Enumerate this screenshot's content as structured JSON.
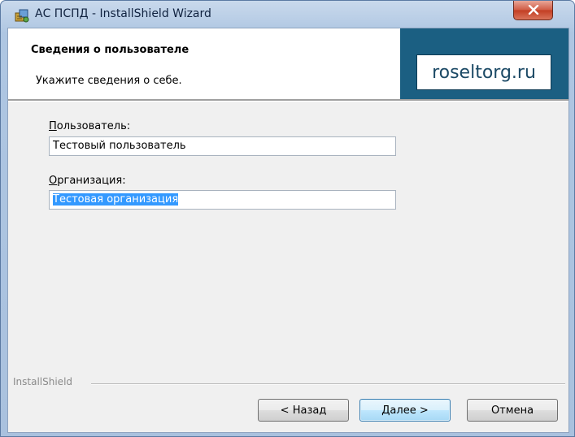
{
  "window": {
    "title": "АС ПСПД - InstallShield Wizard",
    "icon": "installer-icon",
    "close_icon": "close-icon"
  },
  "header": {
    "title": "Сведения о пользователе",
    "subtitle": "Укажите сведения о себе.",
    "brand": "roseltorg.ru"
  },
  "form": {
    "user": {
      "label_hotkey": "П",
      "label_rest": "ользователь:",
      "value": "Тестовый пользователь"
    },
    "org": {
      "label_hotkey": "О",
      "label_rest": "рганизация:",
      "value": "Тестовая организация",
      "selected": true
    }
  },
  "footer": {
    "brand": "InstallShield"
  },
  "buttons": {
    "back": "< Назад",
    "next": "Далее >",
    "cancel": "Отмена"
  },
  "colors": {
    "brand_bg": "#1b5f82",
    "selection": "#3399ff",
    "close_button": "#c8452a"
  }
}
